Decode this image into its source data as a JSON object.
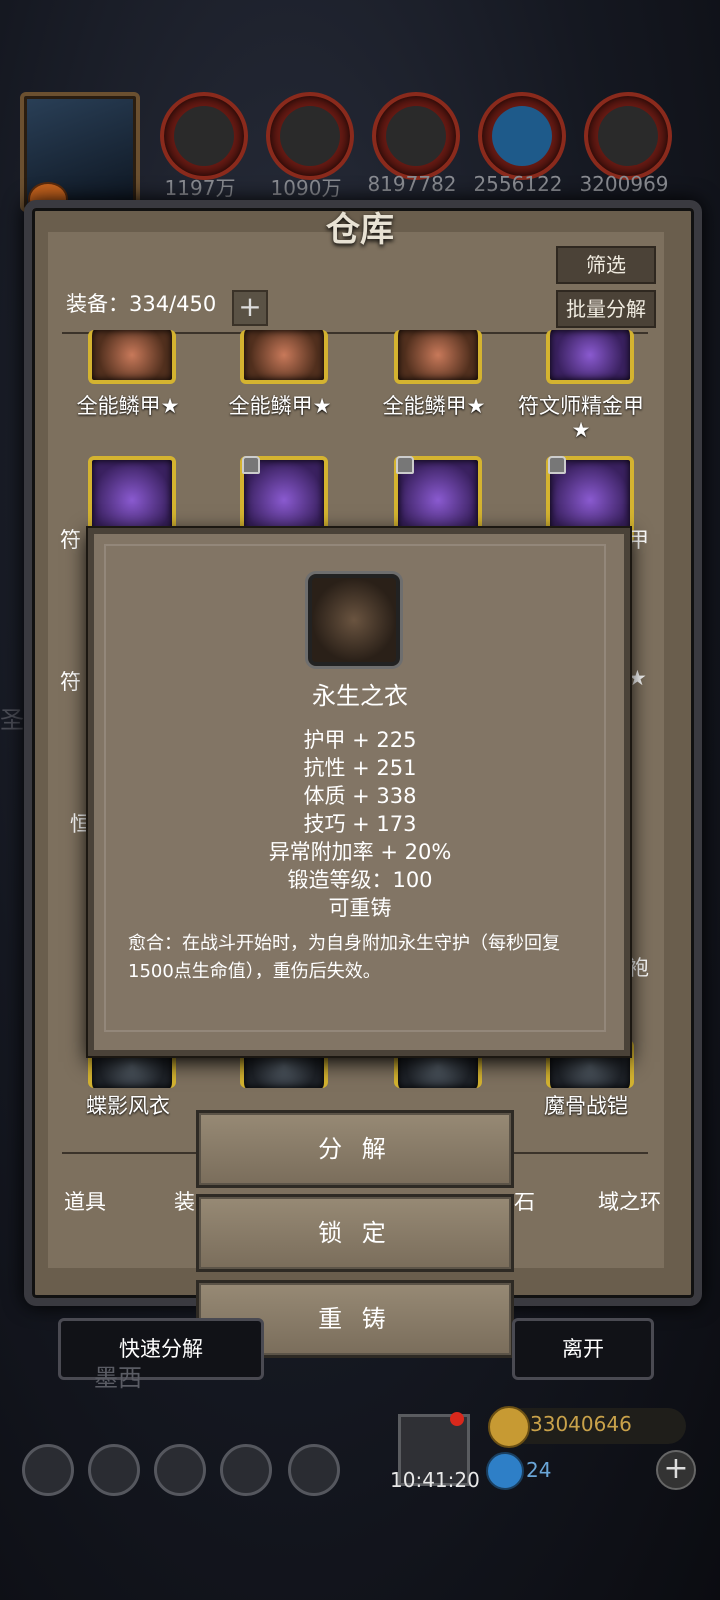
{
  "resources": [
    {
      "icon": "meat-icon",
      "value": "1197万"
    },
    {
      "icon": "wood-icon",
      "value": "1090万"
    },
    {
      "icon": "iron-ingot-icon",
      "value": "8197782"
    },
    {
      "icon": "crystal-icon",
      "value": "2556122"
    },
    {
      "icon": "anvil-icon",
      "value": "3200969"
    }
  ],
  "panel": {
    "title": "仓库",
    "filter_label": "筛选",
    "bulk_dismantle_label": "批量分解",
    "equip_count": "装备：334/450",
    "add_label": "+"
  },
  "items": {
    "row1": [
      "全能鳞甲★",
      "全能鳞甲★",
      "全能鳞甲★",
      "符文师精金甲"
    ],
    "row1_star_wrap": "★",
    "row2_left": "符",
    "row2_right": "甲",
    "row3_left": "符",
    "row3_right": "★",
    "row4_left": "恒",
    "row5_right": "袍",
    "row6": [
      "蝶影风衣",
      "",
      "",
      "魔骨战铠"
    ]
  },
  "tabs": [
    "道具",
    "装",
    "石",
    "域之环"
  ],
  "popup": {
    "name": "永生之衣",
    "stats": [
      "护甲 + 225",
      "抗性 + 251",
      "体质 + 338",
      "技巧 + 173",
      "异常附加率 + 20%",
      "锻造等级：100",
      "可重铸"
    ],
    "description": "愈合：在战斗开始时，为自身附加永生守护（每秒回复1500点生命值），重伤后失效。"
  },
  "actions": {
    "dismantle": "分 解",
    "lock": "锁 定",
    "recast": "重 铸"
  },
  "bottom": {
    "quick_dismantle": "快速分解",
    "leave": "离开",
    "ghost_text": "墨西"
  },
  "hud": {
    "gold": "33040646",
    "gems": "24",
    "time": "10:41:20",
    "plus": "+",
    "side_char": "圣"
  }
}
